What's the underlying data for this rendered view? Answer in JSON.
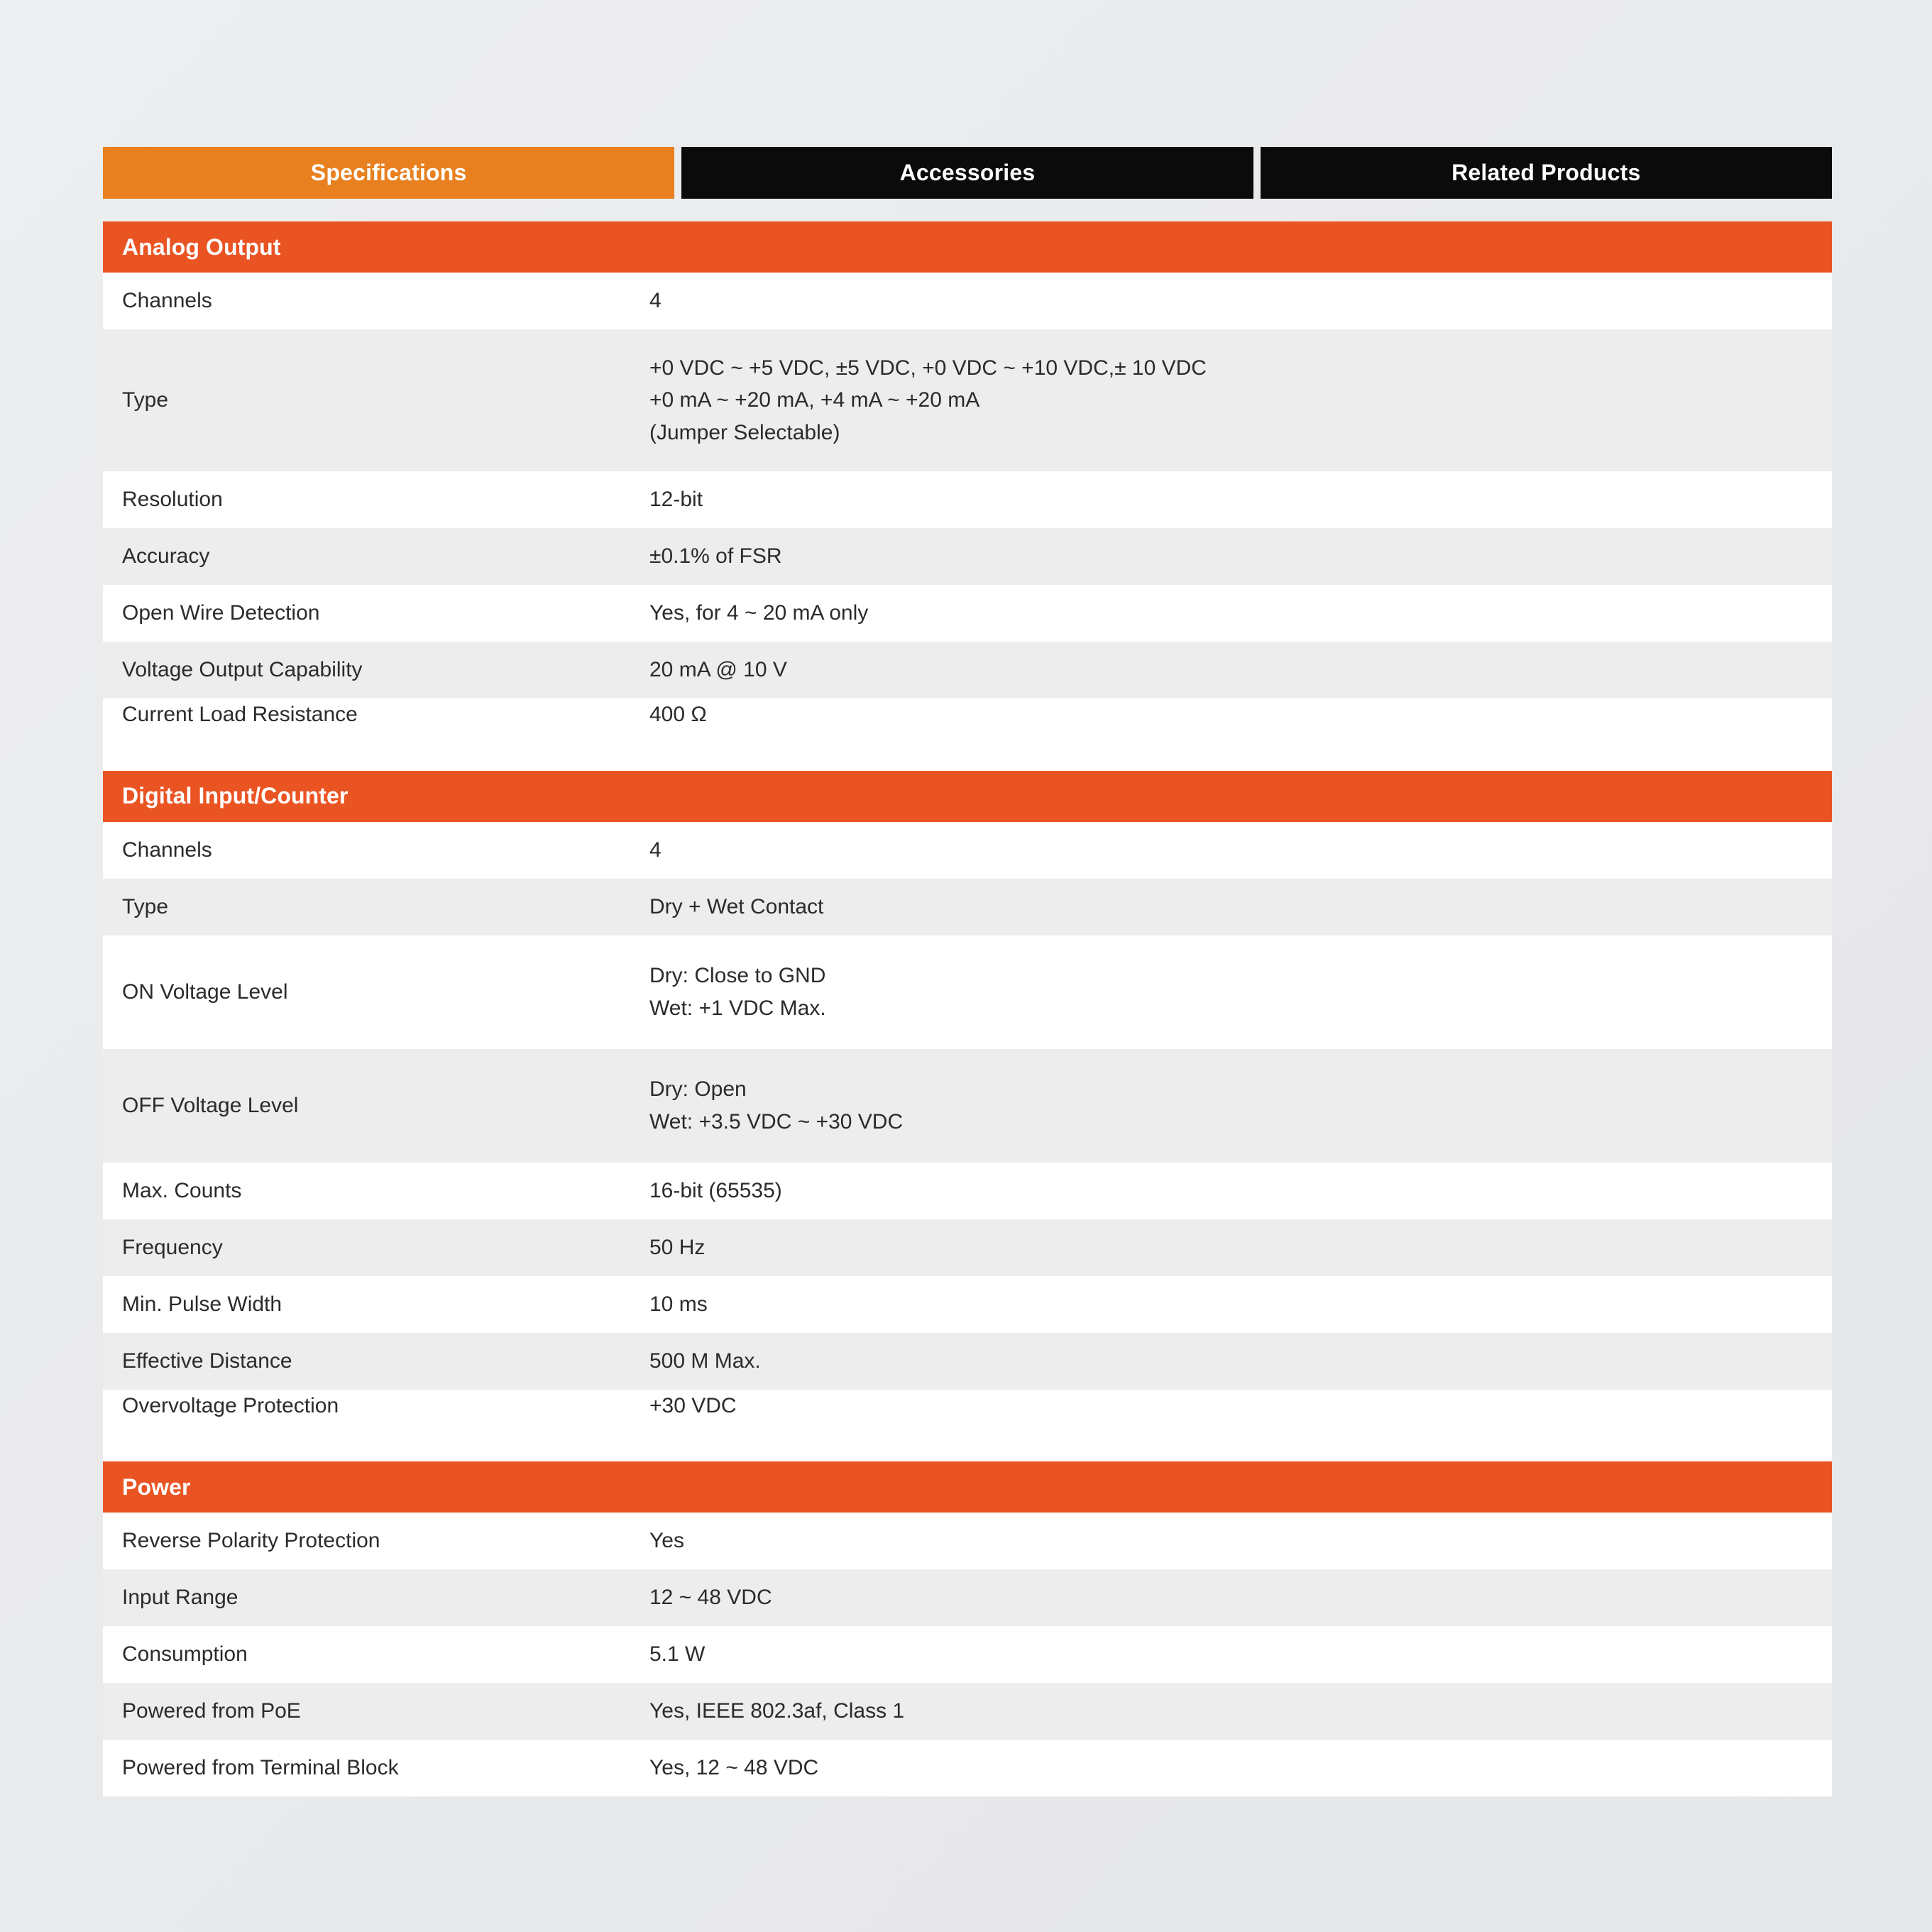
{
  "colors": {
    "page_background": "#ebeced",
    "tab_active": "#e8801f",
    "tab_inactive": "#0b0b0b",
    "section_header": "#ea5423",
    "row_light": "#ffffff",
    "row_alt": "#ededed",
    "text": "#2b2b2b"
  },
  "tabs": [
    {
      "label": "Specifications",
      "active": true
    },
    {
      "label": "Accessories",
      "active": false
    },
    {
      "label": "Related Products",
      "active": false
    }
  ],
  "sections": [
    {
      "title": "Analog Output",
      "rows": [
        {
          "label": "Channels",
          "value": "4"
        },
        {
          "label": "Type",
          "value": "+0 VDC ~ +5 VDC, ±5 VDC, +0 VDC ~ +10 VDC,± 10 VDC\n+0 mA ~ +20 mA, +4 mA ~ +20 mA\n(Jumper Selectable)"
        },
        {
          "label": "Resolution",
          "value": "12-bit"
        },
        {
          "label": "Accuracy",
          "value": "±0.1% of FSR"
        },
        {
          "label": "Open Wire Detection",
          "value": "Yes, for 4 ~ 20 mA only"
        },
        {
          "label": "Voltage Output Capability",
          "value": "20 mA @ 10 V"
        },
        {
          "label": "Current Load Resistance",
          "value": "400 Ω"
        }
      ]
    },
    {
      "title": "Digital Input/Counter",
      "rows": [
        {
          "label": "Channels",
          "value": "4"
        },
        {
          "label": "Type",
          "value": "Dry + Wet Contact"
        },
        {
          "label": "ON Voltage Level",
          "value": "Dry: Close to GND\nWet: +1 VDC Max."
        },
        {
          "label": "OFF Voltage Level",
          "value": "Dry: Open\nWet: +3.5 VDC ~ +30 VDC"
        },
        {
          "label": "Max. Counts",
          "value": "16-bit (65535)"
        },
        {
          "label": "Frequency",
          "value": "50 Hz"
        },
        {
          "label": "Min. Pulse Width",
          "value": "10 ms"
        },
        {
          "label": "Effective Distance",
          "value": "500 M Max."
        },
        {
          "label": "Overvoltage Protection",
          "value": "+30 VDC"
        }
      ]
    },
    {
      "title": "Power",
      "rows": [
        {
          "label": "Reverse Polarity Protection",
          "value": "Yes"
        },
        {
          "label": "Input Range",
          "value": "12 ~ 48 VDC"
        },
        {
          "label": "Consumption",
          "value": "5.1 W"
        },
        {
          "label": "Powered from PoE",
          "value": "Yes, IEEE 802.3af, Class 1"
        },
        {
          "label": "Powered from Terminal Block",
          "value": "Yes, 12 ~ 48 VDC"
        }
      ]
    }
  ]
}
